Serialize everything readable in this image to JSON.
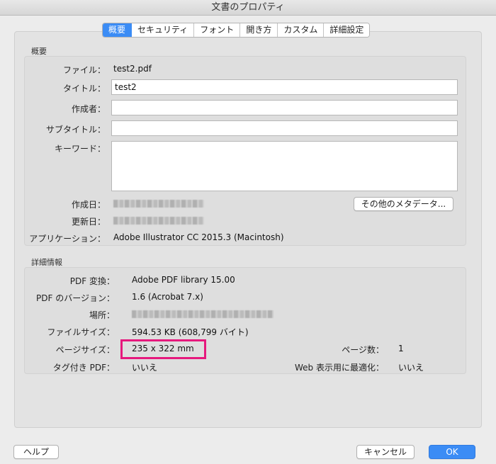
{
  "window": {
    "title": "文書のプロパティ"
  },
  "tabs": [
    "概要",
    "セキュリティ",
    "フォント",
    "開き方",
    "カスタム",
    "詳細設定"
  ],
  "summary": {
    "section_title": "概要",
    "file_label": "ファイル：",
    "file_value": "test2.pdf",
    "title_label": "タイトル：",
    "title_value": "test2",
    "author_label": "作成者：",
    "author_value": "",
    "subject_label": "サブタイトル：",
    "subject_value": "",
    "keywords_label": "キーワード：",
    "keywords_value": "",
    "created_label": "作成日：",
    "modified_label": "更新日：",
    "application_label": "アプリケーション：",
    "application_value": "Adobe Illustrator CC 2015.3 (Macintosh)",
    "metadata_button": "その他のメタデータ..."
  },
  "advanced": {
    "section_title": "詳細情報",
    "pdf_producer_label": "PDF 変換：",
    "pdf_producer_value": "Adobe PDF library 15.00",
    "pdf_version_label": "PDF のバージョン：",
    "pdf_version_value": "1.6 (Acrobat 7.x)",
    "location_label": "場所：",
    "file_size_label": "ファイルサイズ：",
    "file_size_value": "594.53 KB (608,799 バイト)",
    "page_size_label": "ページサイズ：",
    "page_size_value": "235 x 322 mm",
    "page_count_label": "ページ数：",
    "page_count_value": "1",
    "tagged_pdf_label": "タグ付き PDF：",
    "tagged_pdf_value": "いいえ",
    "fast_web_view_label": "Web 表示用に最適化：",
    "fast_web_view_value": "いいえ"
  },
  "footer": {
    "help": "ヘルプ",
    "cancel": "キャンセル",
    "ok": "OK"
  },
  "colors": {
    "accent": "#3b8cf5",
    "highlight": "#e6197d"
  }
}
